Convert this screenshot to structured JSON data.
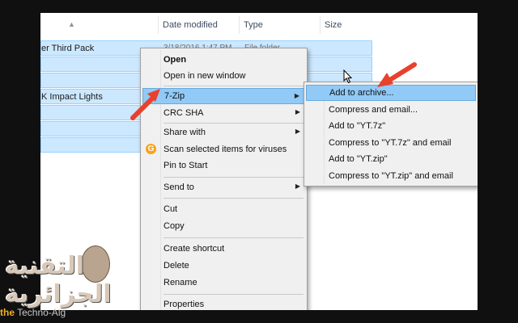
{
  "explorer": {
    "columns": {
      "date_modified": "Date modified",
      "type": "Type",
      "size": "Size"
    },
    "rows": [
      {
        "name": "er Third Pack",
        "date": "3/18/2016 1:47 PM",
        "type": "File folder"
      },
      {
        "name": "",
        "date": "",
        "type": ""
      },
      {
        "name": "",
        "date": "",
        "type": ""
      },
      {
        "name": "K Impact Lights",
        "date": "",
        "type": ""
      },
      {
        "name": "",
        "date": "",
        "type": ""
      },
      {
        "name": "",
        "date": "",
        "type": ""
      },
      {
        "name": "",
        "date": "",
        "type": ""
      }
    ]
  },
  "context_menu": {
    "items": {
      "open": "Open",
      "open_new_window": "Open in new window",
      "seven_zip": "7-Zip",
      "crc_sha": "CRC SHA",
      "share_with": "Share with",
      "scan": "Scan selected items for viruses",
      "pin_to_start": "Pin to Start",
      "send_to": "Send to",
      "cut": "Cut",
      "copy": "Copy",
      "create_shortcut": "Create shortcut",
      "delete": "Delete",
      "rename": "Rename",
      "properties": "Properties"
    }
  },
  "submenu_7zip": {
    "items": [
      "Add to archive...",
      "Compress and email...",
      "Add to \"YT.7z\"",
      "Compress to \"YT.7z\" and email",
      "Add to \"YT.zip\"",
      "Compress to \"YT.zip\" and email"
    ]
  },
  "watermark": {
    "arabic": "التقنية الجزائرية",
    "english_prefix": "the",
    "english_rest": " Techno-Alg"
  },
  "colors": {
    "highlight": "#91c9f7",
    "selection": "#cce8ff",
    "annotation_arrow": "#e8412c"
  },
  "icons": [
    "sort-up-icon",
    "submenu-arrow-icon",
    "scan-shield-icon",
    "mouse-cursor-icon"
  ]
}
